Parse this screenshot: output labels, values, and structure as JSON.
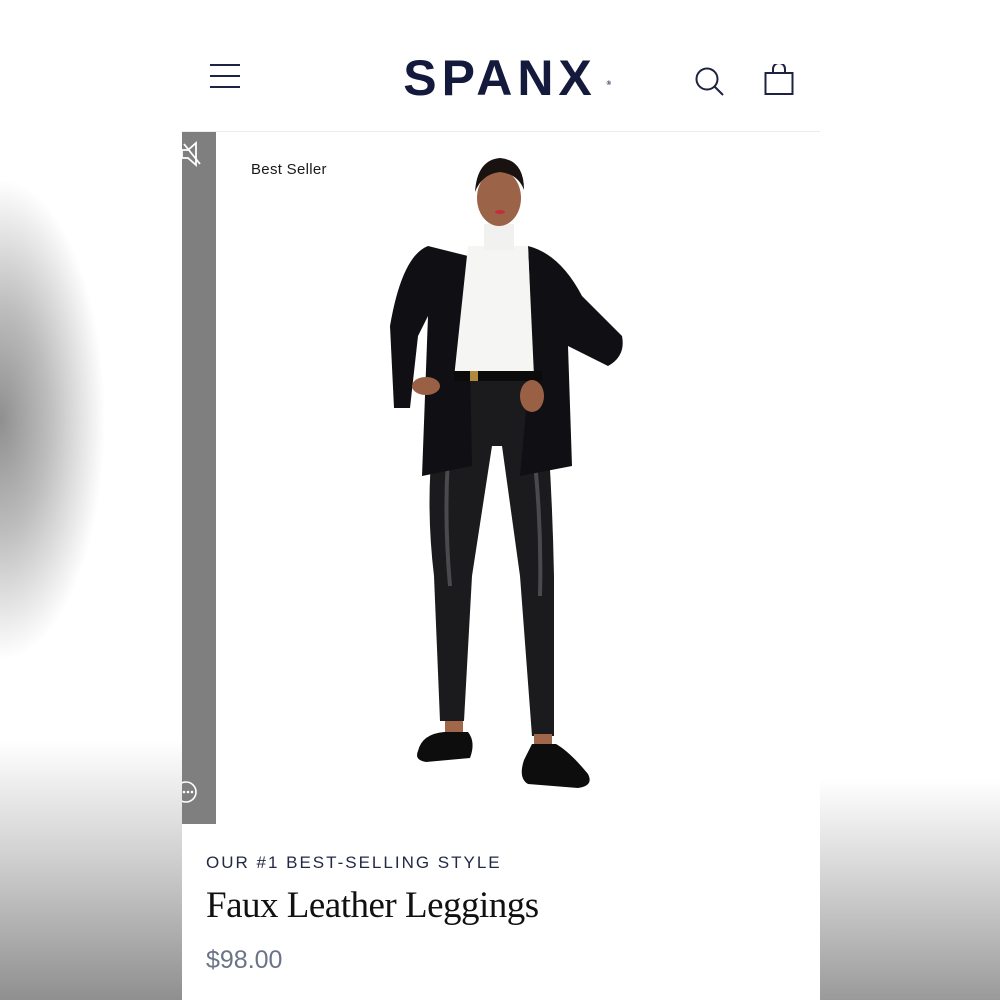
{
  "header": {
    "brand": "SPANX",
    "brand_mark": "®",
    "icons": {
      "menu": "hamburger-menu-icon",
      "search": "search-icon",
      "bag": "shopping-bag-icon"
    }
  },
  "gallery": {
    "badge": "Best Seller",
    "icons": {
      "mute": "mute-icon",
      "more": "more-options-icon"
    }
  },
  "product": {
    "eyebrow": "OUR #1 BEST-SELLING STYLE",
    "name": "Faux Leather Leggings",
    "price": "$98.00"
  },
  "colors": {
    "brand_navy": "#141a3c",
    "price_gray": "#6b7486",
    "strip_gray": "#7f7f7f"
  }
}
